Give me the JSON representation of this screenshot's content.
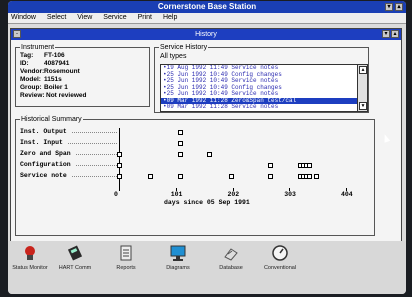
{
  "app": {
    "title": "Cornerstone Base Station",
    "menu": [
      "Window",
      "Select",
      "View",
      "Service",
      "Print",
      "Help"
    ]
  },
  "history_window": {
    "title": "History",
    "instrument": {
      "legend": "Instrument",
      "rows": [
        {
          "label": "Tag:",
          "value": "FT-106"
        },
        {
          "label": "ID:",
          "value": "4087941"
        },
        {
          "label": "Vendor:",
          "value": "Rosemount"
        },
        {
          "label": "Model:",
          "value": "1151s"
        },
        {
          "label": "Group:",
          "value": "Boiler 1"
        },
        {
          "label": "Review:",
          "value": "Not reviewed"
        }
      ]
    },
    "service_history": {
      "legend": "Service History",
      "filter": "All types",
      "items": [
        "19 Aug 1992 11:49 Service notes",
        "25 Jun 1992 10:49 Config changes",
        "25 Jun 1992 10:49 Service notes",
        "25 Jun 1992 10:49 Config changes",
        "25 Jun 1992 10:49 Service notes",
        "09 Mar 1992 11:28 Zero&Span test/cal",
        "09 Mar 1992 11:28 Service notes"
      ],
      "selected_index": 5
    },
    "summary": {
      "legend": "Historical Summary",
      "chart_data": {
        "type": "scatter",
        "categories": [
          "Inst. Output",
          "Inst. Input",
          "Zero and Span",
          "Configuration",
          "Service note"
        ],
        "x_ticks": [
          "0",
          "101",
          "202",
          "303",
          "404"
        ],
        "xlabel": "days since 05 Sep 1991",
        "xlim": [
          0,
          404
        ],
        "series": [
          {
            "category": "Inst. Output",
            "x": [
              108
            ]
          },
          {
            "category": "Inst. Input",
            "x": [
              108
            ]
          },
          {
            "category": "Zero and Span",
            "x": [
              0,
              108,
              160
            ]
          },
          {
            "category": "Configuration",
            "x": [
              0,
              268,
              322,
              328,
              333,
              338
            ]
          },
          {
            "category": "Service note",
            "x": [
              0,
              55,
              108,
              200,
              268,
              322,
              328,
              333,
              338,
              350
            ]
          }
        ]
      }
    }
  },
  "toolbar": [
    {
      "label": "Status Monitor",
      "icon": "status-monitor-icon",
      "color": "#c8241c"
    },
    {
      "label": "HART Comm",
      "icon": "hart-comm-icon",
      "color": "#2a2a2a"
    },
    {
      "label": "Reports",
      "icon": "reports-icon",
      "color": "#5a5a5a"
    },
    {
      "label": "Diagrams",
      "icon": "diagrams-icon",
      "color": "#1f8fd2"
    },
    {
      "label": "Database",
      "icon": "database-icon",
      "color": "#6a6a6a"
    },
    {
      "label": "Conventional",
      "icon": "conventional-icon",
      "color": "#333333"
    }
  ]
}
